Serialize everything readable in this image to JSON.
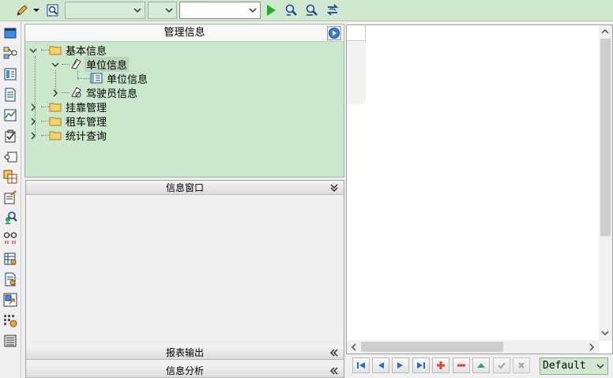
{
  "colors": {
    "toolbar_bg": "#cfe8cf",
    "panel_bg": "#cce8cc",
    "nav_icon_blue": "#1f6fd6",
    "add_red": "#e0452c",
    "delete_red": "#e0452c",
    "play_green": "#22b022"
  },
  "toolbar": {
    "combo1_value": "",
    "combo2_value": "",
    "combo3_value": "",
    "icons": [
      "pencil-icon",
      "dropdown-arrow-icon",
      "search-doc-icon",
      "run-icon",
      "find-icon",
      "find-next-icon",
      "refresh-icon"
    ]
  },
  "left_icons": [
    "window-icon",
    "tree-connect-icon",
    "form-icon",
    "document-icon",
    "chart-icon",
    "checklist-icon",
    "link-icon",
    "table-copy-icon",
    "edit-doc-icon",
    "user-search-icon",
    "glasses-icon",
    "grid-doc-icon",
    "report-icon",
    "export-icon",
    "grid-settings-icon",
    "print-icon"
  ],
  "mgmt": {
    "title": "管理信息",
    "tree": [
      {
        "label": "基本信息",
        "level": 0,
        "expanded": true,
        "icon": "folder-icon"
      },
      {
        "label": "单位信息",
        "level": 1,
        "expanded": true,
        "icon": "unit-icon",
        "selected": true
      },
      {
        "label": "单位信息",
        "level": 2,
        "icon": "form-icon"
      },
      {
        "label": "驾驶员信息",
        "level": 1,
        "expanded": false,
        "icon": "driver-icon"
      },
      {
        "label": "挂靠管理",
        "level": 0,
        "expanded": false,
        "icon": "folder-icon"
      },
      {
        "label": "租车管理",
        "level": 0,
        "expanded": false,
        "icon": "folder-icon"
      },
      {
        "label": "统计查询",
        "level": 0,
        "expanded": false,
        "icon": "folder-icon"
      }
    ]
  },
  "info_window": {
    "title": "信息窗口",
    "report_output": "报表输出",
    "info_analysis": "信息分析"
  },
  "nav": {
    "buttons": [
      "first-record-icon",
      "prev-record-icon",
      "next-record-icon",
      "last-record-icon",
      "add-icon",
      "delete-icon",
      "up-icon",
      "confirm-icon",
      "cancel-icon"
    ],
    "style_value": "Default"
  }
}
